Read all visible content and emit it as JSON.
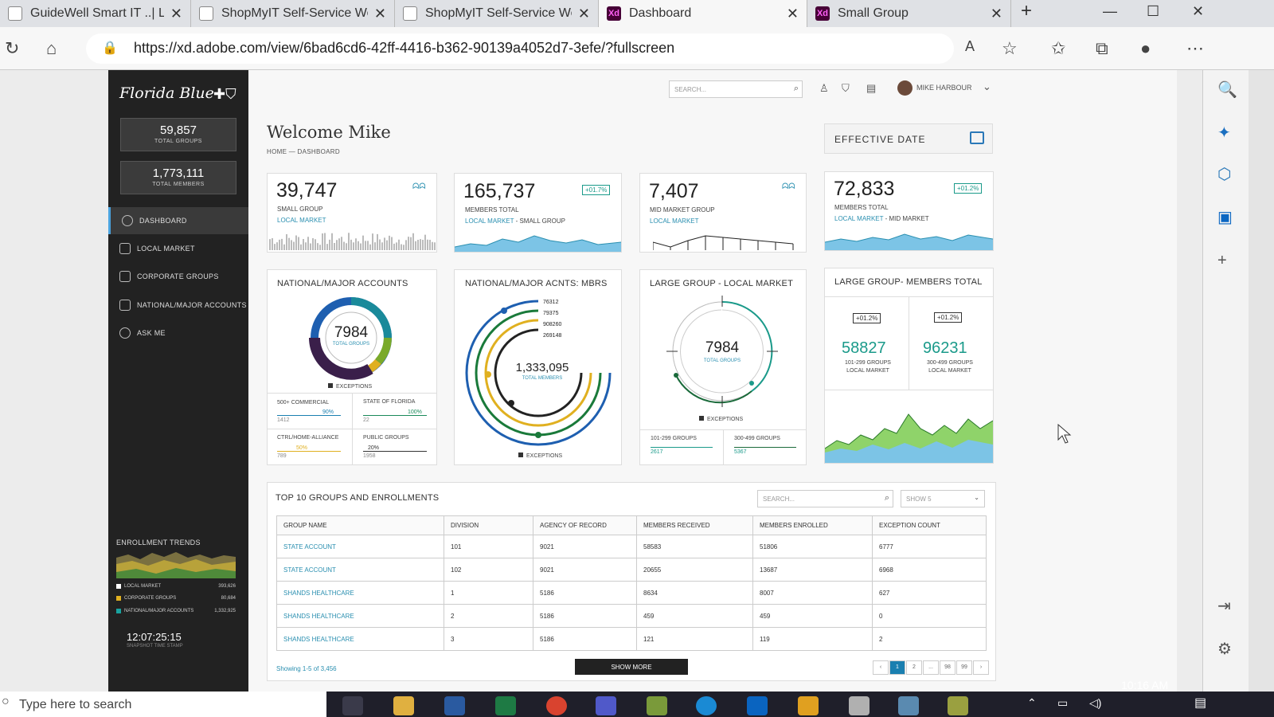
{
  "browser": {
    "tabs": [
      {
        "title": "GuideWell Smart IT ..| Log",
        "icon": "doc-icon"
      },
      {
        "title": "ShopMyIT Self-Service We",
        "icon": "doc-icon"
      },
      {
        "title": "ShopMyIT Self-Service We",
        "icon": "doc-icon"
      },
      {
        "title": "Dashboard",
        "icon": "xd-icon"
      },
      {
        "title": "Small Group",
        "icon": "xd-icon"
      }
    ],
    "active_tab": 3,
    "url": "https://xd.adobe.com/view/6bad6cd6-42ff-4416-b362-90139a4052d7-3efe/?fullscreen"
  },
  "sidebar": {
    "logo": "Florida Blue",
    "stats": [
      {
        "value": "59,857",
        "label": "TOTAL GROUPS"
      },
      {
        "value": "1,773,111",
        "label": "TOTAL MEMBERS"
      }
    ],
    "nav": [
      {
        "label": "DASHBOARD",
        "active": true
      },
      {
        "label": "LOCAL MARKET"
      },
      {
        "label": "CORPORATE GROUPS"
      },
      {
        "label": "NATIONAL/MAJOR ACCOUNTS"
      },
      {
        "label": "ASK ME"
      }
    ],
    "trends": {
      "title": "ENROLLMENT TRENDS",
      "legend": [
        {
          "label": "LOCAL MARKET",
          "value": "393,626",
          "color": "#ffffff"
        },
        {
          "label": "CORPORATE GROUPS",
          "value": "80,684",
          "color": "#e0b020"
        },
        {
          "label": "NATIONAL/MAJOR ACCOUNTS",
          "value": "1,332,925",
          "color": "#19a3a0"
        }
      ]
    },
    "timestamp": "12:07:25:15",
    "timestamp_label": "SNAPSHOT TIME STAMP"
  },
  "header": {
    "search_placeholder": "SEARCH...",
    "user": "MIKE HARBOUR"
  },
  "page": {
    "welcome": "Welcome Mike",
    "breadcrumb": "HOME  —  DASHBOARD",
    "effective_date": "EFFECTIVE DATE"
  },
  "kpis": [
    {
      "value": "39,747",
      "label": "SMALL GROUP",
      "sub1": "LOCAL MARKET",
      "sub2": ""
    },
    {
      "value": "165,737",
      "label": "MEMBERS TOTAL",
      "sub1": "LOCAL MARKET",
      "sub2": " - SMALL GROUP",
      "badge": "+01.7%"
    },
    {
      "value": "7,407",
      "label": "MID MARKET GROUP",
      "sub1": "LOCAL MARKET",
      "sub2": ""
    },
    {
      "value": "72,833",
      "label": "MEMBERS TOTAL",
      "sub1": "LOCAL MARKET",
      "sub2": " - MID MARKET",
      "badge": "+01.2%"
    }
  ],
  "panels": {
    "national": {
      "title": "NATIONAL/MAJOR ACCOUNTS",
      "center_value": "7984",
      "center_label": "TOTAL GROUPS",
      "legend": "EXCEPTIONS",
      "stats": [
        {
          "label": "500+ COMMERCIAL",
          "pct": "90%",
          "value": "1412"
        },
        {
          "label": "STATE OF FLORIDA",
          "pct": "100%",
          "value": "22"
        },
        {
          "label": "CTRL/HOME-ALLIANCE",
          "pct": "50%",
          "value": "789"
        },
        {
          "label": "PUBLIC GROUPS",
          "pct": "20%",
          "value": "1958"
        }
      ]
    },
    "mbrs": {
      "title": "NATIONAL/MAJOR ACNTS: MBRS",
      "rings": [
        "76312",
        "79375",
        "908260",
        "269148"
      ],
      "center_value": "1,333,095",
      "center_label": "TOTAL MEMBERS",
      "legend": "EXCEPTIONS"
    },
    "large_local": {
      "title": "LARGE GROUP - LOCAL MARKET",
      "center_value": "7984",
      "center_label": "TOTAL GROUPS",
      "legend": "EXCEPTIONS",
      "stats": [
        {
          "label": "101-299 GROUPS",
          "value": "2617"
        },
        {
          "label": "300-499 GROUPS",
          "value": "5367"
        }
      ]
    },
    "large_members": {
      "title": "LARGE GROUP- MEMBERS TOTAL",
      "cols": [
        {
          "badge": "+01.2%",
          "value": "58827",
          "l1": "101-299 GROUPS",
          "l2": "LOCAL MARKET"
        },
        {
          "badge": "+01.2%",
          "value": "96231",
          "l1": "300-499 GROUPS",
          "l2": "LOCAL MARKET"
        }
      ]
    }
  },
  "table": {
    "title": "TOP 10 GROUPS AND ENROLLMENTS",
    "search_placeholder": "SEARCH...",
    "show": "SHOW 5",
    "headers": [
      "GROUP NAME",
      "DIVISION",
      "AGENCY OF RECORD",
      "MEMBERS RECEIVED",
      "MEMBERS ENROLLED",
      "EXCEPTION COUNT"
    ],
    "rows": [
      [
        "STATE ACCOUNT",
        "101",
        "9021",
        "58583",
        "51806",
        "6777"
      ],
      [
        "STATE ACCOUNT",
        "102",
        "9021",
        "20655",
        "13687",
        "6968"
      ],
      [
        "SHANDS HEALTHCARE",
        "1",
        "5186",
        "8634",
        "8007",
        "627"
      ],
      [
        "SHANDS HEALTHCARE",
        "2",
        "5186",
        "459",
        "459",
        "0"
      ],
      [
        "SHANDS HEALTHCARE",
        "3",
        "5186",
        "121",
        "119",
        "2"
      ]
    ],
    "showing": "Showing 1-5 of 3,456",
    "show_more": "SHOW MORE",
    "pages": [
      "‹",
      "1",
      "2",
      "...",
      "98",
      "99",
      "›"
    ]
  },
  "taskbar": {
    "search_placeholder": "Type here to search",
    "time": "10:16 AM"
  }
}
